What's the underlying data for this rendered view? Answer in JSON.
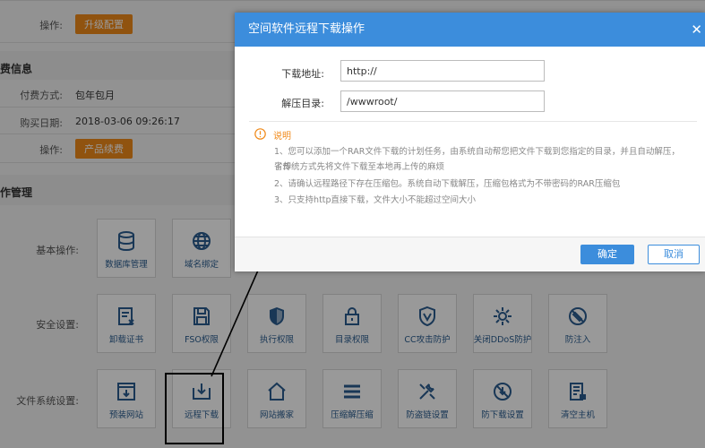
{
  "config": {
    "operation_label": "操作:",
    "upgrade_button": "升级配置"
  },
  "billing": {
    "section_title": "费信息",
    "pay_method_label": "付费方式:",
    "pay_method_value": "包年包月",
    "purchase_date_label": "购买日期:",
    "purchase_date_value": "2018-03-06 09:26:17",
    "operation_label": "操作:",
    "renew_button": "产品续费"
  },
  "management": {
    "section_title": "作管理",
    "basic_label": "基本操作:",
    "security_label": "安全设置:",
    "filesystem_label": "文件系统设置:",
    "basic_tiles": [
      {
        "label": "数据库管理",
        "icon": "database-icon"
      },
      {
        "label": "域名绑定",
        "icon": "globe-icon"
      }
    ],
    "security_tiles": [
      {
        "label": "卸载证书",
        "icon": "certificate-icon"
      },
      {
        "label": "FSO权限",
        "icon": "save-icon"
      },
      {
        "label": "执行权限",
        "icon": "shield-icon"
      },
      {
        "label": "目录权限",
        "icon": "lock-icon"
      },
      {
        "label": "CC攻击防护",
        "icon": "shield-v-icon"
      },
      {
        "label": "关闭DDoS防护",
        "icon": "gear-icon"
      },
      {
        "label": "防注入",
        "icon": "no-inject-icon"
      }
    ],
    "filesystem_tiles": [
      {
        "label": "预装网站",
        "icon": "download-window-icon"
      },
      {
        "label": "远程下载",
        "icon": "remote-download-icon"
      },
      {
        "label": "网站搬家",
        "icon": "home-icon"
      },
      {
        "label": "压缩解压缩",
        "icon": "menu-icon"
      },
      {
        "label": "防盗链设置",
        "icon": "tools-icon"
      },
      {
        "label": "防下载设置",
        "icon": "no-download-icon"
      },
      {
        "label": "清空主机",
        "icon": "clear-host-icon"
      }
    ]
  },
  "dialog": {
    "title": "空间软件远程下载操作",
    "close_symbol": "✕",
    "url_label": "下载地址:",
    "url_value": "http://",
    "dir_label": "解压目录:",
    "dir_value": "/wwwroot/",
    "note_title": "说明",
    "notes": [
      "1、您可以添加一个RAR文件下载的计划任务，由系统自动帮您把文件下载到您指定的目录，并且自动解压，省却",
      "了传统方式先将文件下载至本地再上传的麻烦",
      "2、请确认远程路径下存在压缩包。系统自动下载解压，压缩包格式为不带密码的RAR压缩包",
      "3、只支持http直接下载，文件大小不能超过空间大小"
    ],
    "ok_button": "确定",
    "cancel_button": "取消"
  },
  "colors": {
    "accent": "#3c8ddc",
    "orange": "#f08a1a",
    "icon": "#2a5d8f"
  }
}
